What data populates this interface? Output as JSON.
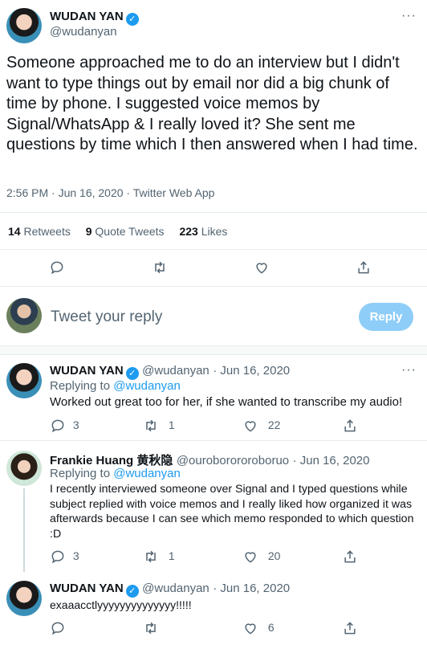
{
  "main_tweet": {
    "name": "WUDAN YAN",
    "handle": "@wudanyan",
    "text": "Someone approached me to do an interview but I didn't want to type things out by email nor did a big chunk of time by phone. I suggested voice memos by Signal/WhatsApp & I really loved it? She sent me questions by time which I then answered when I had time.",
    "timestamp": "2:56 PM · Jun 16, 2020 · Twitter Web App",
    "retweets_count": "14",
    "retweets_label": "Retweets",
    "quotes_count": "9",
    "quotes_label": "Quote Tweets",
    "likes_count": "223",
    "likes_label": "Likes"
  },
  "reply_box": {
    "placeholder": "Tweet your reply",
    "button": "Reply"
  },
  "replies": [
    {
      "name": "WUDAN YAN",
      "handle": "@wudanyan",
      "date": "· Jun 16, 2020",
      "replying_label": "Replying to",
      "replying_to": "@wudanyan",
      "text": "Worked out great too for her, if she wanted to transcribe my audio!",
      "reply_count": "3",
      "retweet_count": "1",
      "like_count": "22"
    },
    {
      "name": "Frankie Huang 黄秋隐",
      "handle": "@ouroborororoboruo",
      "date": "· Jun 16, 2020",
      "replying_label": "Replying to",
      "replying_to": "@wudanyan",
      "text": "I recently interviewed someone over Signal and I typed questions while subject replied with voice memos and I really liked how organized it was afterwards because I can see which memo responded to which question :D",
      "reply_count": "3",
      "retweet_count": "1",
      "like_count": "20"
    },
    {
      "name": "WUDAN YAN",
      "handle": "@wudanyan",
      "date": "· Jun 16, 2020",
      "text": "exaaacctlyyyyyyyyyyyyyy!!!!!",
      "like_count": "6"
    }
  ],
  "colors": {
    "accent": "#1d9bf0",
    "muted": "#536471",
    "reply_button_bg": "#8ecdf8"
  }
}
